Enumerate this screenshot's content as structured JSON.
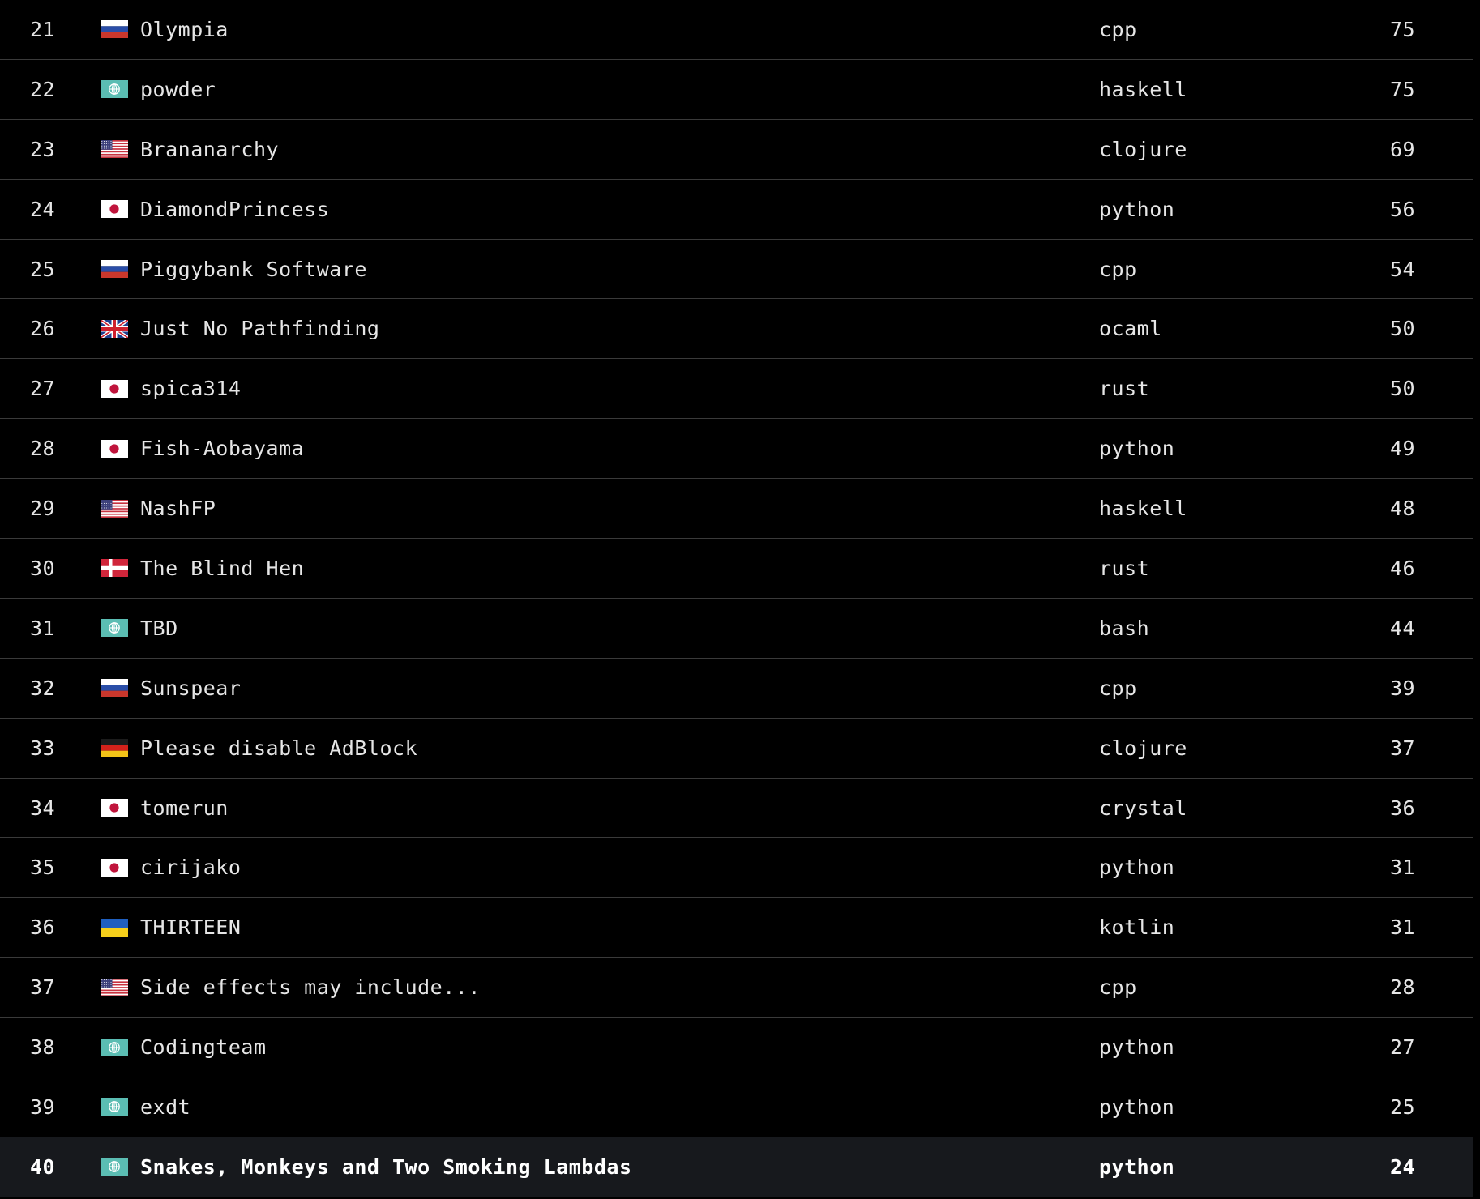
{
  "leaderboard": {
    "rows": [
      {
        "rank": "21",
        "flag": "russia-flag-icon",
        "team": "Olympia",
        "language": "cpp",
        "score": "75"
      },
      {
        "rank": "22",
        "flag": "globe-flag-icon",
        "team": "powder",
        "language": "haskell",
        "score": "75"
      },
      {
        "rank": "23",
        "flag": "usa-flag-icon",
        "team": "Brananarchy",
        "language": "clojure",
        "score": "69"
      },
      {
        "rank": "24",
        "flag": "japan-flag-icon",
        "team": "DiamondPrincess",
        "language": "python",
        "score": "56"
      },
      {
        "rank": "25",
        "flag": "russia-flag-icon",
        "team": "Piggybank Software",
        "language": "cpp",
        "score": "54"
      },
      {
        "rank": "26",
        "flag": "uk-flag-icon",
        "team": "Just No Pathfinding",
        "language": "ocaml",
        "score": "50"
      },
      {
        "rank": "27",
        "flag": "japan-flag-icon",
        "team": "spica314",
        "language": "rust",
        "score": "50"
      },
      {
        "rank": "28",
        "flag": "japan-flag-icon",
        "team": "Fish-Aobayama",
        "language": "python",
        "score": "49"
      },
      {
        "rank": "29",
        "flag": "usa-flag-icon",
        "team": "NashFP",
        "language": "haskell",
        "score": "48"
      },
      {
        "rank": "30",
        "flag": "denmark-flag-icon",
        "team": "The Blind Hen",
        "language": "rust",
        "score": "46"
      },
      {
        "rank": "31",
        "flag": "globe-flag-icon",
        "team": "TBD",
        "language": "bash",
        "score": "44"
      },
      {
        "rank": "32",
        "flag": "russia-flag-icon",
        "team": "Sunspear",
        "language": "cpp",
        "score": "39"
      },
      {
        "rank": "33",
        "flag": "germany-flag-icon",
        "team": "Please disable AdBlock",
        "language": "clojure",
        "score": "37"
      },
      {
        "rank": "34",
        "flag": "japan-flag-icon",
        "team": "tomerun",
        "language": "crystal",
        "score": "36"
      },
      {
        "rank": "35",
        "flag": "japan-flag-icon",
        "team": "cirijako",
        "language": "python",
        "score": "31"
      },
      {
        "rank": "36",
        "flag": "ukraine-flag-icon",
        "team": "THIRTEEN",
        "language": "kotlin",
        "score": "31"
      },
      {
        "rank": "37",
        "flag": "usa-flag-icon",
        "team": "Side effects may include...",
        "language": "cpp",
        "score": "28"
      },
      {
        "rank": "38",
        "flag": "globe-flag-icon",
        "team": "Codingteam",
        "language": "python",
        "score": "27"
      },
      {
        "rank": "39",
        "flag": "globe-flag-icon",
        "team": "exdt",
        "language": "python",
        "score": "25"
      },
      {
        "rank": "40",
        "flag": "globe-flag-icon",
        "team": "Snakes, Monkeys and Two Smoking Lambdas",
        "language": "python",
        "score": "24",
        "highlighted": true
      }
    ]
  },
  "colors": {
    "background": "#000000",
    "text": "#e6e6e6",
    "divider": "#3a3a3a",
    "highlight_row": "#17191d",
    "globe_flag": "#5bbdb3"
  }
}
